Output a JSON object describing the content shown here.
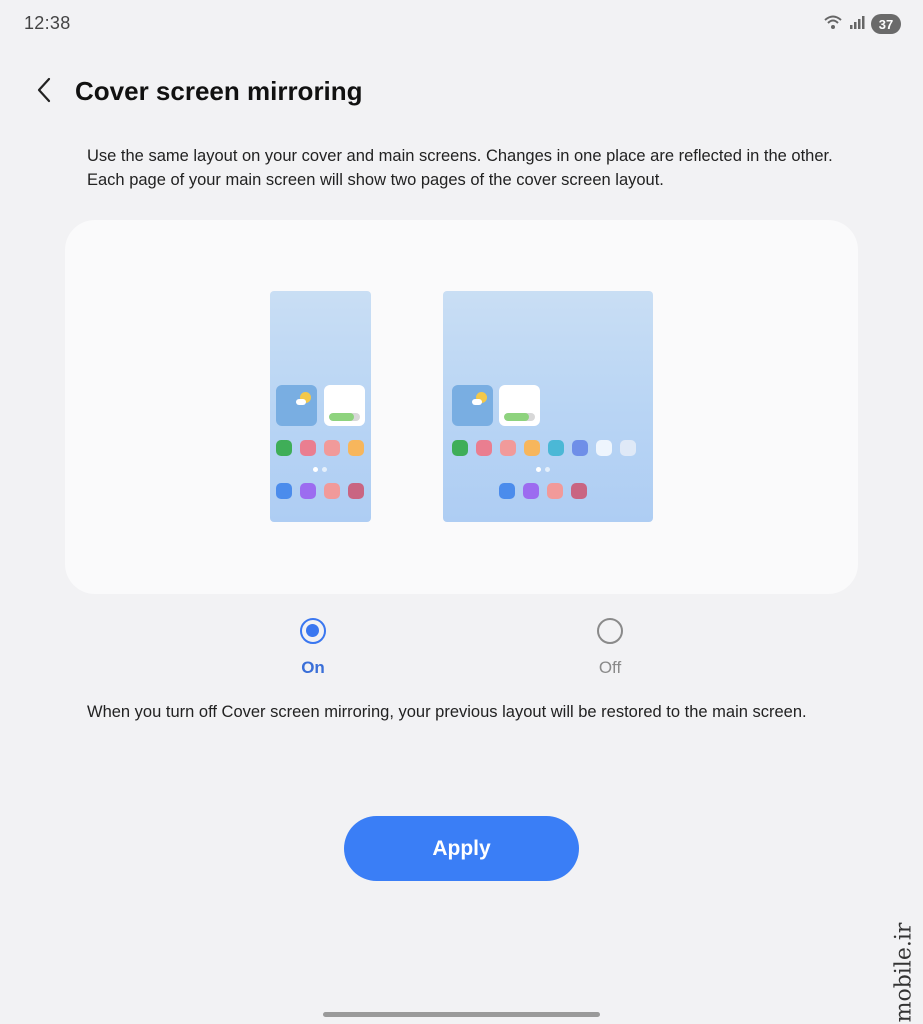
{
  "status_bar": {
    "time": "12:38",
    "battery_level": "37",
    "icons": [
      "wifi-icon",
      "signal-icon",
      "battery-icon"
    ]
  },
  "header": {
    "title": "Cover screen mirroring",
    "back_icon": "chevron-left-icon"
  },
  "description": "Use the same layout on your cover and main screens. Changes in one place are reflected in the other. Each page of your main screen will show two pages of the cover screen layout.",
  "preview": {
    "cover_row1_colors": [
      "#3fae58",
      "#ea7e90",
      "#f19a9a",
      "#f7b65c"
    ],
    "cover_row2_colors": [
      "#4b8cec",
      "#9c6cf0",
      "#f19a9a",
      "#c96582"
    ],
    "main_row1_colors": [
      "#3fae58",
      "#ea7e90",
      "#f19a9a",
      "#f7b65c",
      "#4bb8d6",
      "#6f8fe8",
      "#eef5fd",
      "#dfe9f7"
    ],
    "main_row2_colors": [
      "#4b8cec",
      "#9c6cf0",
      "#f19a9a",
      "#c96582"
    ]
  },
  "options": {
    "selected": "on",
    "on_label": "On",
    "off_label": "Off"
  },
  "note": "When you turn off Cover screen mirroring, your previous layout will be restored to the main screen.",
  "apply_label": "Apply",
  "watermark": "mobile.ir",
  "colors": {
    "accent": "#3a7ef6",
    "background": "#f2f2f4",
    "card": "#fafafb"
  }
}
